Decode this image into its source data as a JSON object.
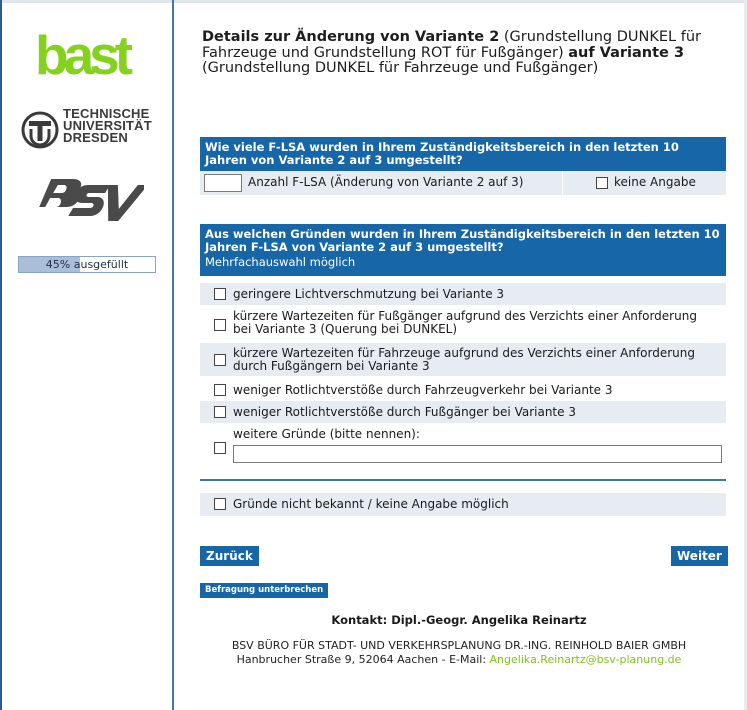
{
  "sidebar": {
    "logo_bast": "bast",
    "logo_tud_lines": [
      "TECHNISCHE",
      "UNIVERSITÄT",
      "DRESDEN"
    ],
    "logo_bsv": "BSV",
    "progress_percent": 45,
    "progress_label": "45% ausgefüllt"
  },
  "title": {
    "part1_bold": "Details zur Änderung von Variante 2",
    "part2": " (Grundstellung DUNKEL für Fahrzeuge und Grundstellung ROT für Fußgänger) ",
    "part3_bold": "auf Variante 3",
    "part4": " (Grundstellung DUNKEL für Fahrzeuge und Fußgänger)"
  },
  "question1": {
    "header": "Wie viele F-LSA wurden in Ihrem Zuständigkeitsbereich in den letzten 10 Jahren von Variante 2 auf 3 umgestellt?",
    "input_label": "Anzahl F-LSA (Änderung von Variante 2 auf 3)",
    "input_value": "",
    "no_answer_label": "keine Angabe"
  },
  "question2": {
    "header": "Aus welchen Gründen wurden in Ihrem Zuständigkeitsbereich in den letzten 10 Jahren F-LSA von Variante 2 auf 3 umgestellt?",
    "hint": "Mehrfachauswahl möglich",
    "options": [
      "geringere Lichtverschmutzung bei Variante 3",
      "kürzere Wartezeiten für Fußgänger aufgrund des Verzichts einer Anforderung bei Variante 3 (Querung bei DUNKEL)",
      "kürzere Wartezeiten für Fahrzeuge aufgrund des Verzichts einer Anforderung durch Fußgängern bei Variante 3",
      "weniger Rotlichtverstöße durch Fahrzeugverkehr bei Variante 3",
      "weniger Rotlichtverstöße durch Fußgänger bei Variante 3",
      "weitere Gründe (bitte nennen):"
    ],
    "other_value": "",
    "not_known_label": "Gründe nicht bekannt / keine Angabe möglich"
  },
  "buttons": {
    "back": "Zurück",
    "next": "Weiter",
    "interrupt": "Befragung unterbrechen"
  },
  "contact": {
    "name": "Kontakt: Dipl.-Geogr. Angelika Reinartz",
    "firm": "BSV BÜRO FÜR STADT- UND VERKEHRSPLANUNG DR.-ING. REINHOLD BAIER GMBH",
    "address": "Hanbrucher Straße 9, 52064 Aachen - E-Mail: ",
    "email": "Angelika.Reinartz@bsv-planung.de"
  },
  "colors": {
    "accent_blue": "#1766a8",
    "row_shade": "#e7ecf3",
    "bast_green": "#84d21d",
    "email_green": "#84c21d"
  }
}
